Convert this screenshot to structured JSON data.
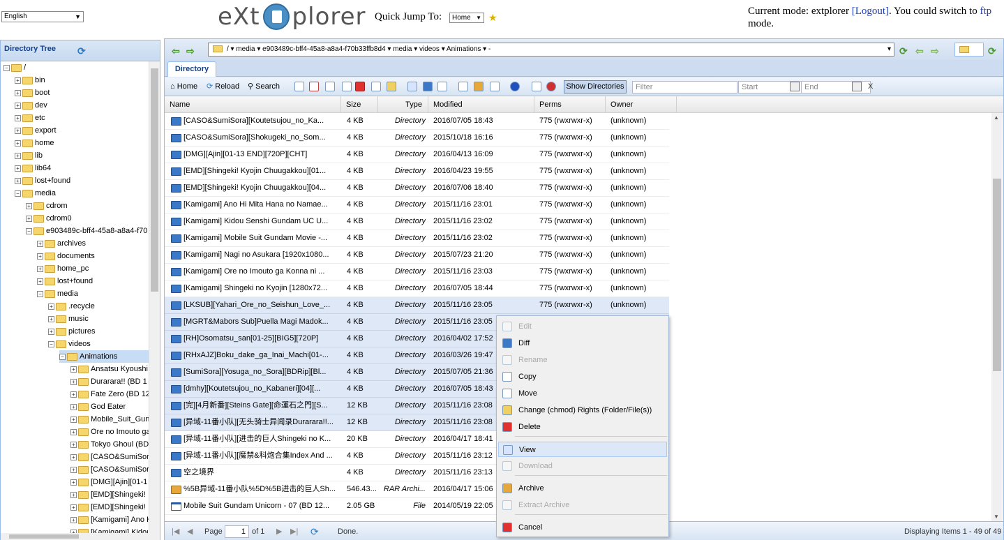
{
  "header": {
    "language": "English",
    "logo_left": "eXt",
    "logo_right": "plorer",
    "quick_jump_label": "Quick Jump To:",
    "quick_jump_value": "Home",
    "mode_text_1": "Current mode: extplorer ",
    "logout_link": "[Logout]",
    "mode_text_2": ". You could switch to ",
    "ftp_link": "ftp",
    "mode_text_3": " mode."
  },
  "sidebar": {
    "title": "Directory Tree",
    "tree": [
      {
        "label": "/",
        "depth": 0,
        "expanded": true
      },
      {
        "label": "bin",
        "depth": 1
      },
      {
        "label": "boot",
        "depth": 1
      },
      {
        "label": "dev",
        "depth": 1
      },
      {
        "label": "etc",
        "depth": 1
      },
      {
        "label": "export",
        "depth": 1
      },
      {
        "label": "home",
        "depth": 1
      },
      {
        "label": "lib",
        "depth": 1
      },
      {
        "label": "lib64",
        "depth": 1
      },
      {
        "label": "lost+found",
        "depth": 1
      },
      {
        "label": "media",
        "depth": 1,
        "expanded": true
      },
      {
        "label": "cdrom",
        "depth": 2
      },
      {
        "label": "cdrom0",
        "depth": 2
      },
      {
        "label": "e903489c-bff4-45a8-a8a4-f70",
        "depth": 2,
        "expanded": true
      },
      {
        "label": "archives",
        "depth": 3
      },
      {
        "label": "documents",
        "depth": 3
      },
      {
        "label": "home_pc",
        "depth": 3
      },
      {
        "label": "lost+found",
        "depth": 3
      },
      {
        "label": "media",
        "depth": 3,
        "expanded": true
      },
      {
        "label": ".recycle",
        "depth": 4
      },
      {
        "label": "music",
        "depth": 4
      },
      {
        "label": "pictures",
        "depth": 4
      },
      {
        "label": "videos",
        "depth": 4,
        "expanded": true
      },
      {
        "label": "Animations",
        "depth": 5,
        "expanded": true,
        "selected": true
      },
      {
        "label": "Ansatsu Kyoushi",
        "depth": 6
      },
      {
        "label": "Durarara!! (BD 1",
        "depth": 6
      },
      {
        "label": "Fate Zero (BD 12",
        "depth": 6
      },
      {
        "label": "God Eater",
        "depth": 6
      },
      {
        "label": "Mobile_Suit_Gun",
        "depth": 6
      },
      {
        "label": "Ore no Imouto ga",
        "depth": 6
      },
      {
        "label": "Tokyo Ghoul (BD",
        "depth": 6
      },
      {
        "label": "[CASO&SumiSor",
        "depth": 6
      },
      {
        "label": "[CASO&SumiSor",
        "depth": 6
      },
      {
        "label": "[DMG][Ajin][01-1",
        "depth": 6
      },
      {
        "label": "[EMD][Shingeki!",
        "depth": 6
      },
      {
        "label": "[EMD][Shingeki!",
        "depth": 6
      },
      {
        "label": "[Kamigami] Ano H",
        "depth": 6
      },
      {
        "label": "[Kamigami] Kidou",
        "depth": 6
      }
    ]
  },
  "pathbar": {
    "path": "/  ▾  media  ▾  e903489c-bff4-45a8-a8a4-f70b33ffb8d4  ▾  media  ▾  videos  ▾  Animations  ▾  -"
  },
  "tab": {
    "label": "Directory"
  },
  "toolbar": {
    "home": "Home",
    "reload": "Reload",
    "search": "Search",
    "show_directories": "Show Directories",
    "filter_placeholder": "Filter",
    "start_placeholder": "Start",
    "end_placeholder": "End",
    "clear": "X"
  },
  "grid": {
    "columns": [
      "Name",
      "Size",
      "Type",
      "Modified",
      "Perms",
      "Owner"
    ],
    "rows": [
      {
        "name": "[CASO&SumiSora][Koutetsujou_no_Ka...",
        "size": "4 KB",
        "type": "Directory",
        "modified": "2016/07/05 18:43",
        "perms": "775 (rwxrwxr-x)",
        "owner": "(unknown)",
        "icon": "dir"
      },
      {
        "name": "[CASO&SumiSora][Shokugeki_no_Som...",
        "size": "4 KB",
        "type": "Directory",
        "modified": "2015/10/18 16:16",
        "perms": "775 (rwxrwxr-x)",
        "owner": "(unknown)",
        "icon": "dir"
      },
      {
        "name": "[DMG][Ajin][01-13 END][720P][CHT]",
        "size": "4 KB",
        "type": "Directory",
        "modified": "2016/04/13 16:09",
        "perms": "775 (rwxrwxr-x)",
        "owner": "(unknown)",
        "icon": "dir"
      },
      {
        "name": "[EMD][Shingeki! Kyojin Chuugakkou][01...",
        "size": "4 KB",
        "type": "Directory",
        "modified": "2016/04/23 19:55",
        "perms": "775 (rwxrwxr-x)",
        "owner": "(unknown)",
        "icon": "dir"
      },
      {
        "name": "[EMD][Shingeki! Kyojin Chuugakkou][04...",
        "size": "4 KB",
        "type": "Directory",
        "modified": "2016/07/06 18:40",
        "perms": "775 (rwxrwxr-x)",
        "owner": "(unknown)",
        "icon": "dir"
      },
      {
        "name": "[Kamigami] Ano Hi Mita Hana no Namae...",
        "size": "4 KB",
        "type": "Directory",
        "modified": "2015/11/16 23:01",
        "perms": "775 (rwxrwxr-x)",
        "owner": "(unknown)",
        "icon": "dir"
      },
      {
        "name": "[Kamigami] Kidou Senshi Gundam UC U...",
        "size": "4 KB",
        "type": "Directory",
        "modified": "2015/11/16 23:02",
        "perms": "775 (rwxrwxr-x)",
        "owner": "(unknown)",
        "icon": "dir"
      },
      {
        "name": "[Kamigami] Mobile Suit Gundam Movie -...",
        "size": "4 KB",
        "type": "Directory",
        "modified": "2015/11/16 23:02",
        "perms": "775 (rwxrwxr-x)",
        "owner": "(unknown)",
        "icon": "dir"
      },
      {
        "name": "[Kamigami] Nagi no Asukara [1920x1080...",
        "size": "4 KB",
        "type": "Directory",
        "modified": "2015/07/23 21:20",
        "perms": "775 (rwxrwxr-x)",
        "owner": "(unknown)",
        "icon": "dir"
      },
      {
        "name": "[Kamigami] Ore no Imouto ga Konna ni ...",
        "size": "4 KB",
        "type": "Directory",
        "modified": "2015/11/16 23:03",
        "perms": "775 (rwxrwxr-x)",
        "owner": "(unknown)",
        "icon": "dir"
      },
      {
        "name": "[Kamigami] Shingeki no Kyojin [1280x72...",
        "size": "4 KB",
        "type": "Directory",
        "modified": "2016/07/05 18:44",
        "perms": "775 (rwxrwxr-x)",
        "owner": "(unknown)",
        "icon": "dir"
      },
      {
        "name": "[LKSUB][Yahari_Ore_no_Seishun_Love_...",
        "size": "4 KB",
        "type": "Directory",
        "modified": "2015/11/16 23:05",
        "perms": "775 (rwxrwxr-x)",
        "owner": "(unknown)",
        "icon": "dir",
        "selected": true
      },
      {
        "name": "[MGRT&Mabors Sub]Puella Magi Madok...",
        "size": "4 KB",
        "type": "Directory",
        "modified": "2015/11/16 23:05",
        "perms": "",
        "owner": "",
        "icon": "dir",
        "selected": true
      },
      {
        "name": "[RH]Osomatsu_san[01-25][BIG5][720P]",
        "size": "4 KB",
        "type": "Directory",
        "modified": "2016/04/02 17:52",
        "perms": "",
        "owner": "",
        "icon": "dir",
        "selected": true
      },
      {
        "name": "[RHxAJZ]Boku_dake_ga_Inai_Machi[01-...",
        "size": "4 KB",
        "type": "Directory",
        "modified": "2016/03/26 19:47",
        "perms": "",
        "owner": "",
        "icon": "dir",
        "selected": true
      },
      {
        "name": "[SumiSora][Yosuga_no_Sora][BDRip][Bl...",
        "size": "4 KB",
        "type": "Directory",
        "modified": "2015/07/05 21:36",
        "perms": "",
        "owner": "",
        "icon": "dir",
        "selected": true
      },
      {
        "name": "[dmhy][Koutetsujou_no_Kabaneri][04][...",
        "size": "4 KB",
        "type": "Directory",
        "modified": "2016/07/05 18:43",
        "perms": "",
        "owner": "",
        "icon": "dir",
        "selected": true
      },
      {
        "name": "[完][4月新番][Steins Gate][命運石之門][S...",
        "size": "12 KB",
        "type": "Directory",
        "modified": "2015/11/16 23:08",
        "perms": "",
        "owner": "",
        "icon": "dir",
        "selected": true
      },
      {
        "name": "[异域-11番小队][无头骑士异闻录Durarara!!...",
        "size": "12 KB",
        "type": "Directory",
        "modified": "2015/11/16 23:08",
        "perms": "",
        "owner": "",
        "icon": "dir",
        "selected": true
      },
      {
        "name": "[异域-11番小队][进击的巨人Shingeki no K...",
        "size": "20 KB",
        "type": "Directory",
        "modified": "2016/04/17 18:41",
        "perms": "",
        "owner": "",
        "icon": "dir"
      },
      {
        "name": "[异域-11番小队][魔禁&科炮合集Index And ...",
        "size": "4 KB",
        "type": "Directory",
        "modified": "2015/11/16 23:12",
        "perms": "",
        "owner": "",
        "icon": "dir"
      },
      {
        "name": "空之境界",
        "size": "4 KB",
        "type": "Directory",
        "modified": "2015/11/16 23:13",
        "perms": "",
        "owner": "",
        "icon": "dir"
      },
      {
        "name": "%5B异域-11番小队%5D%5B进击的巨人Sh...",
        "size": "546.43...",
        "type": "RAR Archi...",
        "modified": "2016/04/17 15:06",
        "perms": "",
        "owner": "",
        "icon": "rar"
      },
      {
        "name": "Mobile Suit Gundam Unicorn - 07 (BD 12...",
        "size": "2.05 GB",
        "type": "File",
        "modified": "2014/05/19 22:05",
        "perms": "",
        "owner": "",
        "icon": "file"
      }
    ]
  },
  "paging": {
    "page_label": "Page",
    "page_value": "1",
    "of_label": "of 1",
    "status": "Done.",
    "displaying": "Displaying Items 1 - 49 of 49"
  },
  "context_menu": {
    "items": [
      {
        "label": "Edit",
        "disabled": true,
        "icon": "edit-icon"
      },
      {
        "label": "Diff",
        "disabled": false,
        "icon": "diff-icon"
      },
      {
        "label": "Rename",
        "disabled": true,
        "icon": "rename-icon"
      },
      {
        "label": "Copy",
        "disabled": false,
        "icon": "copy-icon"
      },
      {
        "label": "Move",
        "disabled": false,
        "icon": "move-icon"
      },
      {
        "label": "Change (chmod) Rights (Folder/File(s))",
        "disabled": false,
        "icon": "chmod-icon"
      },
      {
        "label": "Delete",
        "disabled": false,
        "icon": "delete-icon"
      },
      {
        "label": "View",
        "disabled": false,
        "icon": "view-icon",
        "active": true
      },
      {
        "label": "Download",
        "disabled": true,
        "icon": "download-icon"
      },
      {
        "label": "Archive",
        "disabled": false,
        "icon": "archive-icon"
      },
      {
        "label": "Extract Archive",
        "disabled": true,
        "icon": "extract-icon"
      },
      {
        "label": "Cancel",
        "disabled": false,
        "icon": "cancel-icon"
      }
    ]
  }
}
